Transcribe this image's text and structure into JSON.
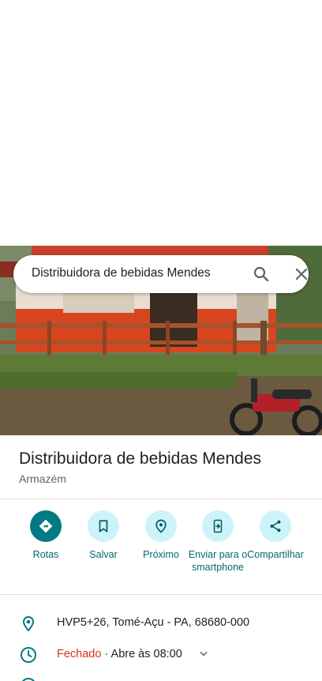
{
  "search": {
    "query": "Distribuidora de bebidas Mendes"
  },
  "place": {
    "name": "Distribuidora de bebidas Mendes",
    "category": "Armazém"
  },
  "actions": [
    {
      "label": "Rotas",
      "icon": "directions-icon",
      "primary": true
    },
    {
      "label": "Salvar",
      "icon": "bookmark-icon",
      "primary": false
    },
    {
      "label": "Próximo",
      "icon": "nearby-icon",
      "primary": false
    },
    {
      "label": "Enviar para o smartphone",
      "icon": "send-to-phone-icon",
      "primary": false
    },
    {
      "label": "Compartilhar",
      "icon": "share-icon",
      "primary": false
    }
  ],
  "info": {
    "address": "HVP5+26, Tomé-Açu - PA, 68680-000",
    "status": "Fechado",
    "hours": " · Abre às 08:00"
  },
  "colors": {
    "accent": "#007b83",
    "accent_light": "#cdf3fa",
    "label": "#006a70",
    "closed": "#d93025"
  }
}
